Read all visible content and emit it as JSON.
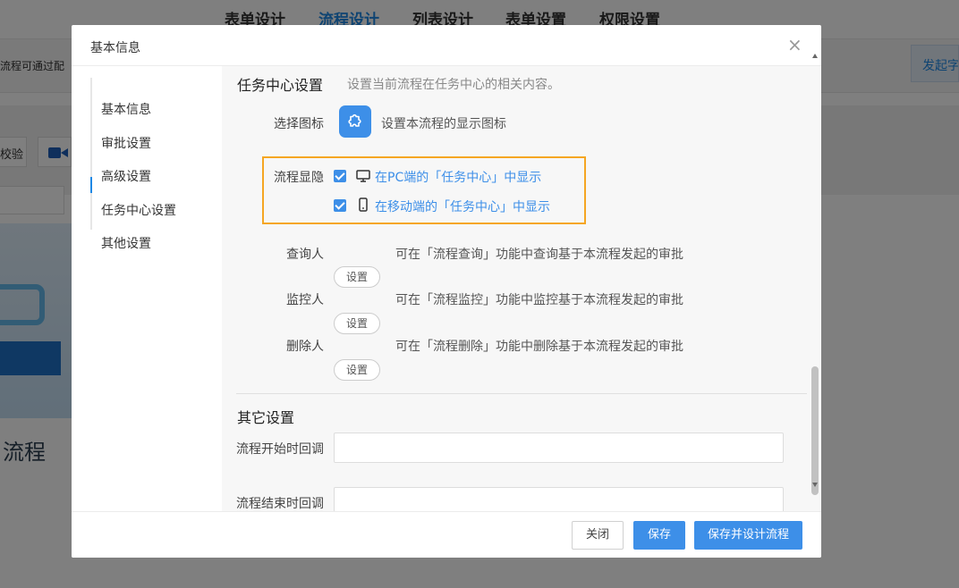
{
  "background": {
    "tabs": [
      "表单设计",
      "流程设计",
      "列表设计",
      "表单设置",
      "权限设置"
    ],
    "active_tab": "流程设计",
    "notice_text": "流程可通过配",
    "launch_button": "发起字",
    "verify_button": "校验",
    "illustration_title": "流程"
  },
  "dialog": {
    "title": "基本信息",
    "nav": [
      "基本信息",
      "审批设置",
      "高级设置",
      "任务中心设置",
      "其他设置"
    ],
    "active_nav": "任务中心设置",
    "task_center": {
      "title": "任务中心设置",
      "desc": "设置当前流程在任务中心的相关内容。",
      "icon_label": "选择图标",
      "icon_desc": "设置本流程的显示图标",
      "visibility_label": "流程显隐",
      "pc_option": "在PC端的「任务中心」中显示",
      "mobile_option": "在移动端的「任务中心」中显示",
      "query_label": "查询人",
      "query_desc": "可在「流程查询」功能中查询基于本流程发起的审批",
      "monitor_label": "监控人",
      "monitor_desc": "可在「流程监控」功能中监控基于本流程发起的审批",
      "delete_label": "删除人",
      "delete_desc": "可在「流程删除」功能中删除基于本流程发起的审批",
      "set_button": "设置"
    },
    "other": {
      "title": "其它设置",
      "start_callback_label": "流程开始时回调",
      "end_callback_label": "流程结束时回调",
      "start_callback_value": "",
      "end_callback_value": ""
    },
    "footer": {
      "close": "关闭",
      "save": "保存",
      "save_and_design": "保存并设计流程"
    }
  },
  "colors": {
    "accent": "#3d8fe8",
    "highlight": "#f5a623"
  }
}
